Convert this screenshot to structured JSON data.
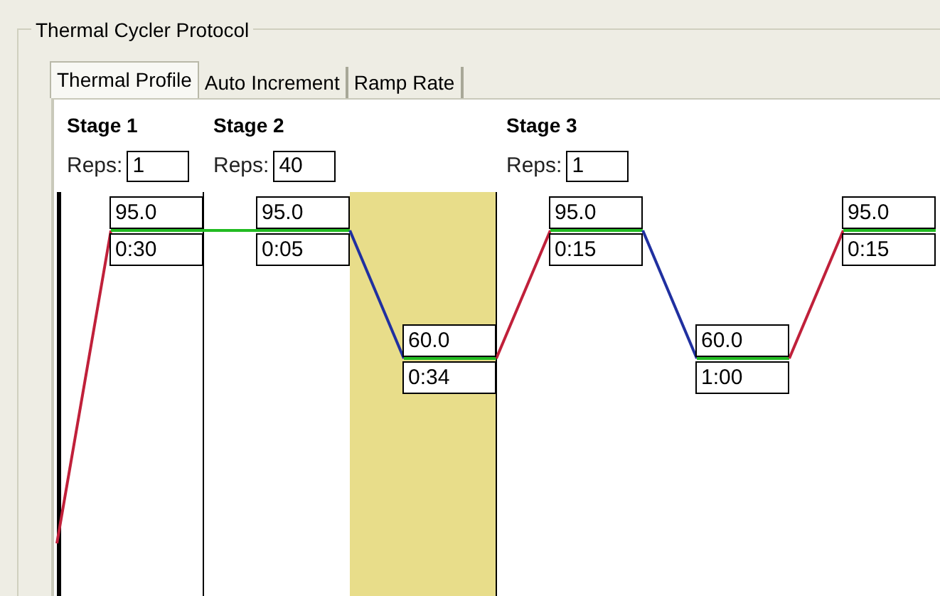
{
  "title": "Thermal Cycler Protocol",
  "tabs": [
    {
      "label": "Thermal Profile",
      "selected": true
    },
    {
      "label": "Auto Increment",
      "selected": false
    },
    {
      "label": "Ramp Rate",
      "selected": false
    }
  ],
  "stages": [
    {
      "label": "Stage 1",
      "reps_label": "Reps:",
      "reps": "1",
      "steps": [
        {
          "temperature": "95.0",
          "time": "0:30",
          "selected": false
        }
      ]
    },
    {
      "label": "Stage 2",
      "reps_label": "Reps:",
      "reps": "40",
      "steps": [
        {
          "temperature": "95.0",
          "time": "0:05",
          "selected": false
        },
        {
          "temperature": "60.0",
          "time": "0:34",
          "selected": true
        }
      ]
    },
    {
      "label": "Stage 3",
      "reps_label": "Reps:",
      "reps": "1",
      "steps": [
        {
          "temperature": "95.0",
          "time": "0:15",
          "selected": false
        },
        {
          "temperature": "60.0",
          "time": "1:00",
          "selected": false
        },
        {
          "temperature": "95.0",
          "time": "0:15",
          "selected": false
        }
      ]
    }
  ]
}
